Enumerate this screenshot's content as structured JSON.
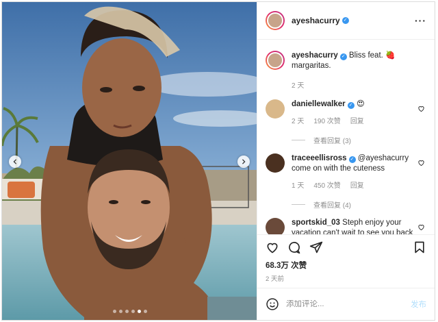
{
  "post": {
    "author": "ayeshacurry",
    "media": {
      "description_icons": [
        "chevron-left-icon",
        "chevron-right-icon"
      ],
      "carousel_count": 6,
      "carousel_active_index": 4
    },
    "caption": {
      "username": "ayeshacurry",
      "text": "Bliss feat. 🍓 margaritas.",
      "time": "2 天"
    },
    "comments": [
      {
        "username": "daniellewalker",
        "verified": true,
        "text": "😍",
        "time": "2 天",
        "likes": "190 次赞",
        "reply_label": "回复",
        "view_replies": "查看回复 (3)"
      },
      {
        "username": "traceeellisross",
        "verified": true,
        "text": "@ayeshacurry come on with the cuteness",
        "time": "1 天",
        "likes": "450 次赞",
        "reply_label": "回复",
        "view_replies": "查看回复 (4)"
      },
      {
        "username": "sportskid_03",
        "verified": false,
        "text": "Steph enjoy your vacation can't wait to see you back"
      }
    ],
    "likes_count": "68.3万 次赞",
    "posted_ago": "2 天前",
    "add_comment": {
      "placeholder": "添加评论...",
      "post_label": "发布"
    },
    "colors": {
      "verified_blue": "#3897f0",
      "post_button_disabled": "#b2dffc",
      "muted_text": "#8e8e8e"
    }
  }
}
